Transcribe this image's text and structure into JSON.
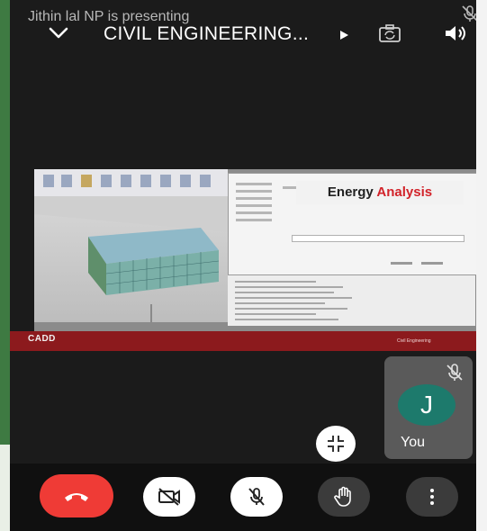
{
  "meeting": {
    "presenting_text": "Jithin lal NP is presenting",
    "title": "CIVIL ENGINEERING..."
  },
  "shared_screen": {
    "banner_word_1": "Energy",
    "banner_word_2": "Analysis",
    "footer_logo": "CADD",
    "footer_right": "Civil Engineering"
  },
  "self_tile": {
    "avatar_initial": "J",
    "label": "You"
  },
  "icons": {
    "collapse": "chevron-down-icon",
    "title_arrow": "play-triangle-icon",
    "camera_switch": "camera-switch-icon",
    "speaker": "speaker-icon",
    "mic_off": "mic-off-icon",
    "minimize": "minimize-icon",
    "end_call": "phone-hangup-icon",
    "camera_off": "camera-off-icon",
    "hand": "raise-hand-icon",
    "more": "more-vertical-icon"
  },
  "colors": {
    "end_call": "#ef3b36",
    "avatar": "#1d7a6c",
    "banner_accent": "#d2232a",
    "app_background": "#1b1b1b"
  }
}
